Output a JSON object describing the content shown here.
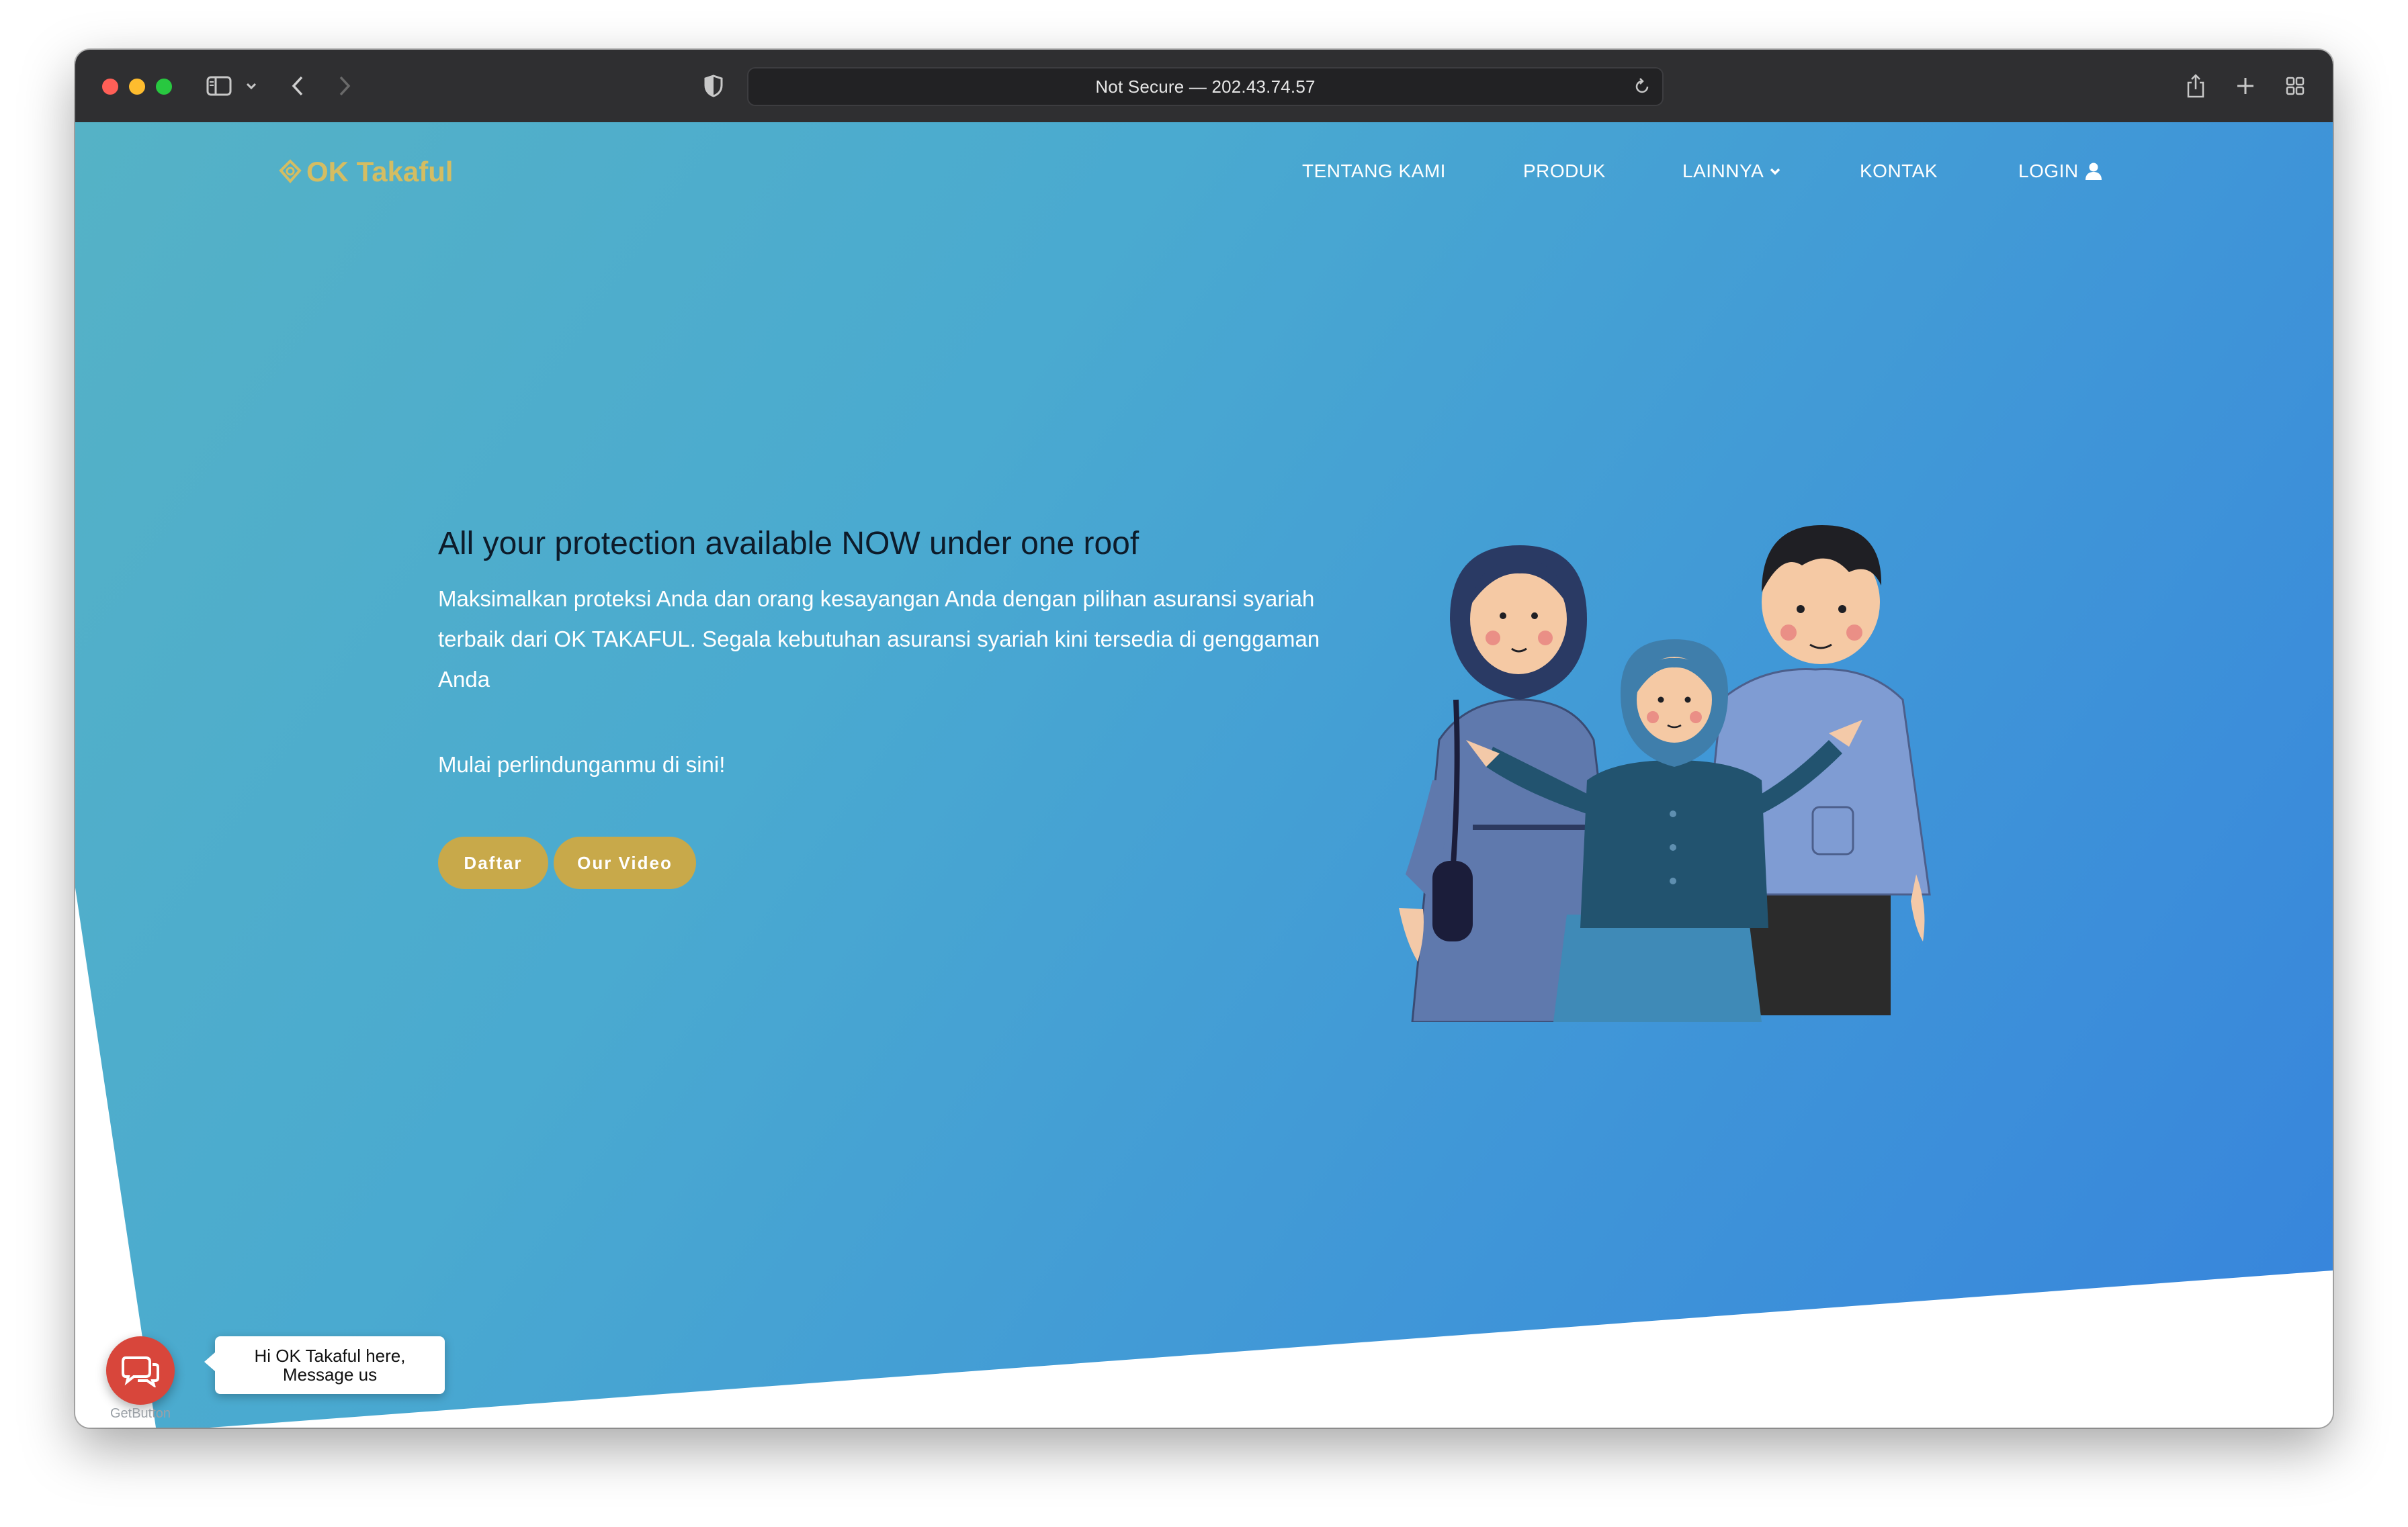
{
  "browser": {
    "url": "Not Secure — 202.43.74.57"
  },
  "site": {
    "logo_text": "OK Takaful",
    "nav": [
      "TENTANG KAMI",
      "PRODUK",
      "LAINNYA",
      "KONTAK",
      "LOGIN"
    ]
  },
  "hero": {
    "headline": "All your protection available NOW under one roof",
    "description": "Maksimalkan proteksi Anda dan orang kesayangan Anda dengan pilihan asuransi syariah terbaik dari OK TAKAFUL. Segala kebutuhan asuransi syariah kini tersedia di genggaman Anda",
    "cta_text": "Mulai perlindunganmu di sini!",
    "buttons": [
      "Daftar",
      "Our Video"
    ]
  },
  "chat_widget": {
    "bubble_line1": "Hi OK Takaful here,",
    "bubble_line2": "Message us",
    "caption": "GetButton"
  },
  "colors": {
    "hero_start": "#55b2c6",
    "hero_end": "#3784dc",
    "brand_gold": "#c8a94a",
    "logo_gold": "#d4bd62",
    "chat_red": "#d8463b"
  },
  "icons": [
    "sidebar-icon",
    "chevron-down-icon",
    "back-icon",
    "forward-icon",
    "shield-icon",
    "reload-icon",
    "share-icon",
    "new-tab-icon",
    "tab-overview-icon",
    "user-icon",
    "chat-icon"
  ]
}
